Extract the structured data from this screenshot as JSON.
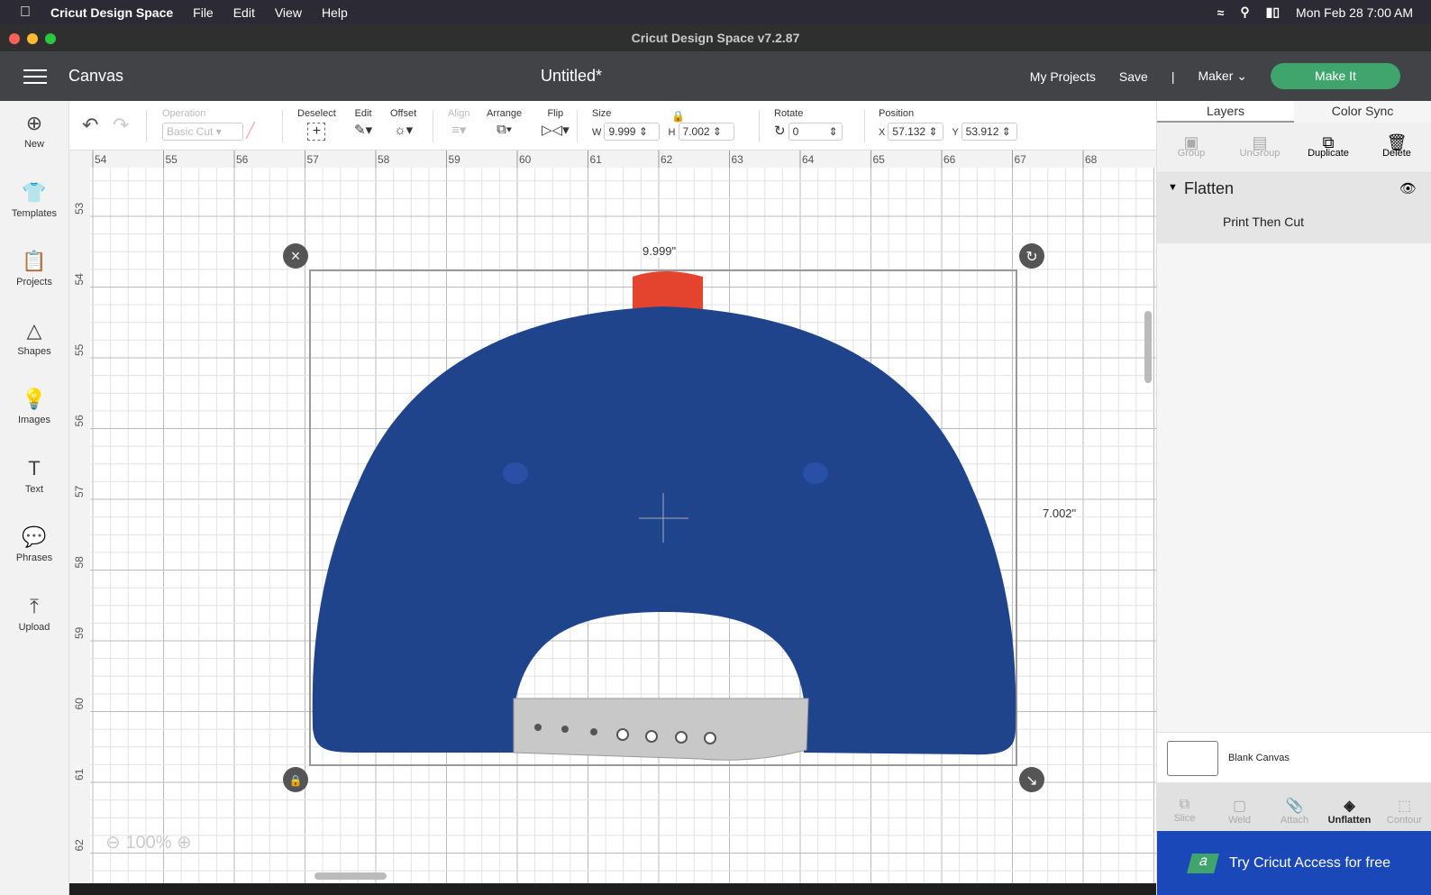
{
  "menubar": {
    "app": "Cricut Design Space",
    "items": [
      "File",
      "Edit",
      "View",
      "Help"
    ],
    "clock": "Mon Feb 28  7:00 AM"
  },
  "window_title": "Cricut Design Space  v7.2.87",
  "header": {
    "section": "Canvas",
    "doc_title": "Untitled*",
    "my_projects": "My Projects",
    "save": "Save",
    "divider": "|",
    "machine": "Maker",
    "make_it": "Make It"
  },
  "leftbar": [
    {
      "label": "New",
      "icon": "plus-circle-icon"
    },
    {
      "label": "Templates",
      "icon": "shirt-icon"
    },
    {
      "label": "Projects",
      "icon": "projects-icon"
    },
    {
      "label": "Shapes",
      "icon": "shapes-icon"
    },
    {
      "label": "Images",
      "icon": "lightbulb-icon"
    },
    {
      "label": "Text",
      "icon": "text-icon"
    },
    {
      "label": "Phrases",
      "icon": "speech-bubble-icon"
    },
    {
      "label": "Upload",
      "icon": "upload-icon"
    }
  ],
  "toolbar": {
    "operation": "Operation",
    "operation_value": "Basic Cut",
    "deselect": "Deselect",
    "edit": "Edit",
    "offset": "Offset",
    "align": "Align",
    "arrange": "Arrange",
    "flip": "Flip",
    "size": "Size",
    "w_label": "W",
    "w": "9.999",
    "h_label": "H",
    "h": "7.002",
    "rotate": "Rotate",
    "rotate_value": "0",
    "position": "Position",
    "x_label": "X",
    "x": "57.132",
    "y_label": "Y",
    "y": "53.912"
  },
  "ruler": {
    "h": [
      "54",
      "55",
      "56",
      "57",
      "58",
      "59",
      "60",
      "61",
      "62",
      "63",
      "64",
      "65",
      "66",
      "67",
      "68"
    ],
    "v": [
      "53",
      "54",
      "55",
      "56",
      "57",
      "58",
      "59",
      "60",
      "61",
      "62"
    ]
  },
  "canvas": {
    "width_label": "9.999\"",
    "height_label": "7.002\"",
    "zoom": "100%"
  },
  "colors": {
    "cap": "#1f448b",
    "button": "#e4432d",
    "accent": "#3fa56d"
  },
  "rpanel": {
    "tabs": [
      "Layers",
      "Color Sync"
    ],
    "tools": [
      "Group",
      "UnGroup",
      "Duplicate",
      "Delete"
    ],
    "group_name": "Flatten",
    "layer_name": "Print Then Cut",
    "blank_canvas": "Blank Canvas",
    "bottom_tools": [
      "Slice",
      "Weld",
      "Attach",
      "Unflatten",
      "Contour"
    ],
    "banner": "Try Cricut Access for free",
    "banner_badge": "a"
  }
}
